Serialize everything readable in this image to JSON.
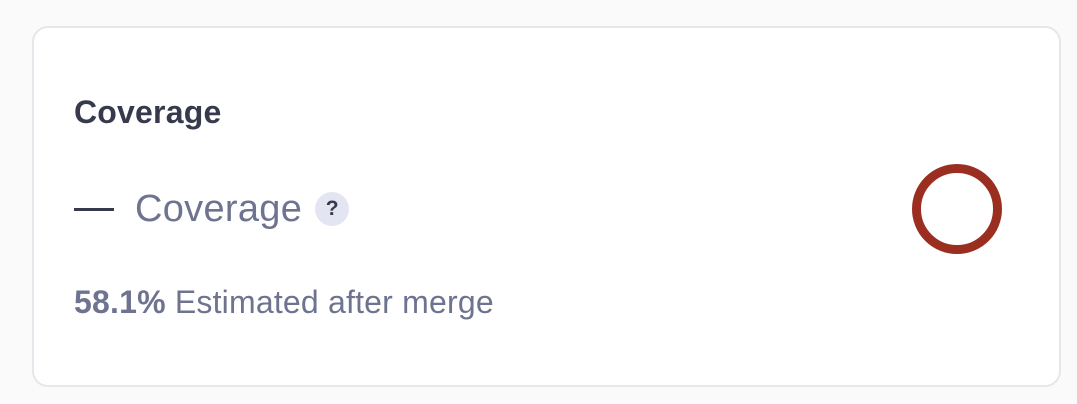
{
  "card": {
    "title": "Coverage",
    "metric": {
      "label": "Coverage",
      "value_placeholder": "—",
      "help_icon": "question-mark-icon",
      "help_glyph": "?"
    },
    "status_indicator": {
      "icon": "empty-ring-icon",
      "color": "#9a2f21"
    },
    "estimate": {
      "value": "58.1%",
      "label": "Estimated after merge"
    }
  }
}
